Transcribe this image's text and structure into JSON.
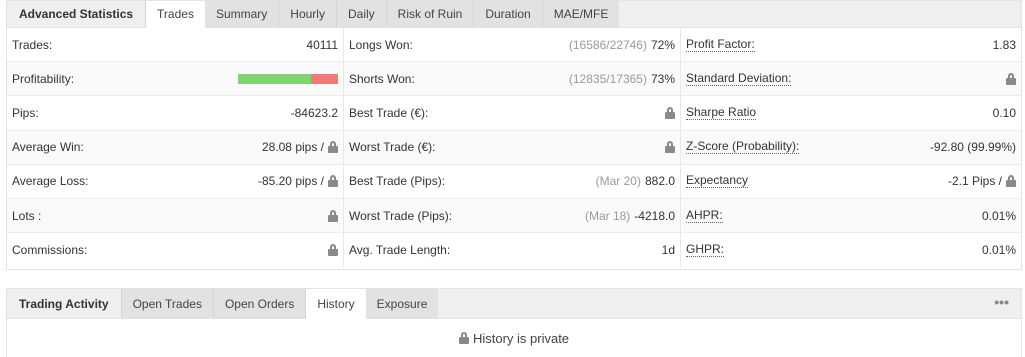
{
  "stats_tabs": {
    "title": "Advanced Statistics",
    "tabs": [
      "Trades",
      "Summary",
      "Hourly",
      "Daily",
      "Risk of Ruin",
      "Duration",
      "MAE/MFE"
    ],
    "active": "Trades"
  },
  "col1": [
    {
      "label": "Trades:",
      "value": "40111"
    },
    {
      "label": "Profitability:",
      "won_fraction": 0.73
    },
    {
      "label": "Pips:",
      "value": "-84623.2"
    },
    {
      "label": "Average Win:",
      "value": "28.08 pips /"
    },
    {
      "label": "Average Loss:",
      "value": "-85.20 pips /"
    },
    {
      "label": "Lots :"
    },
    {
      "label": "Commissions:"
    }
  ],
  "col2": [
    {
      "label": "Longs Won:",
      "detail": "(16586/22746)",
      "value": "72%"
    },
    {
      "label": "Shorts Won:",
      "detail": "(12835/17365)",
      "value": "73%"
    },
    {
      "label": "Best Trade (€):"
    },
    {
      "label": "Worst Trade (€):"
    },
    {
      "label": "Best Trade (Pips):",
      "detail": "(Mar 20)",
      "value": "882.0"
    },
    {
      "label": "Worst Trade (Pips):",
      "detail": "(Mar 18)",
      "value": "-4218.0"
    },
    {
      "label": "Avg. Trade Length:",
      "value": "1d"
    }
  ],
  "col3": [
    {
      "label": "Profit Factor:",
      "value": "1.83"
    },
    {
      "label": "Standard Deviation:"
    },
    {
      "label": "Sharpe Ratio",
      "value": "0.10"
    },
    {
      "label": "Z-Score (Probability):",
      "value": "-92.80 (99.99%)"
    },
    {
      "label": "Expectancy",
      "value": "-2.1 Pips /"
    },
    {
      "label": "AHPR:",
      "value": "0.01%"
    },
    {
      "label": "GHPR:",
      "value": "0.01%"
    }
  ],
  "activity_tabs": {
    "title": "Trading Activity",
    "tabs": [
      "Open Trades",
      "Open Orders",
      "History",
      "Exposure"
    ],
    "active": "History"
  },
  "activity": {
    "message": "History is private"
  },
  "colors": {
    "won": "#7ed66c",
    "lost": "#f07a75"
  }
}
